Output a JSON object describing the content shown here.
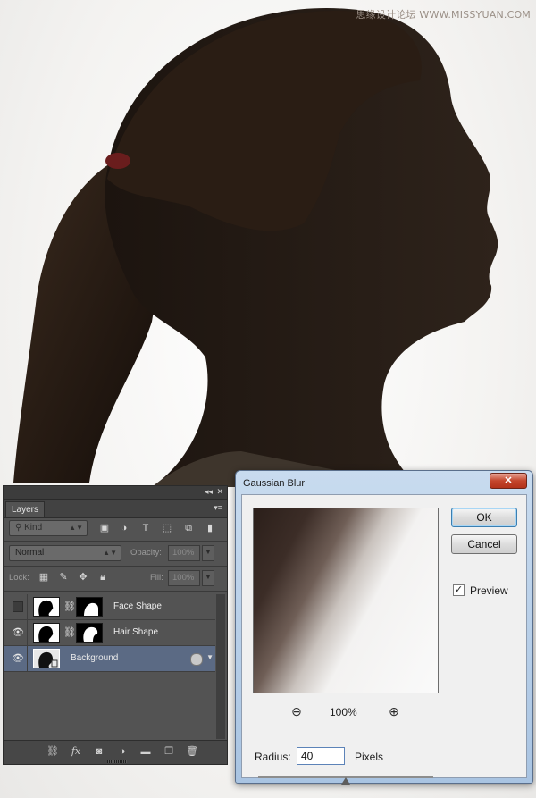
{
  "watermark": "思缘设计论坛 WWW.MISSYUAN.COM",
  "layers_panel": {
    "collapse_icon": "double-chevron-left-icon",
    "close_icon": "close-icon",
    "tab_label": "Layers",
    "menu_icon": "panel-menu-icon",
    "filter": {
      "kind_label": "Kind"
    },
    "blend_mode": "Normal",
    "opacity_label": "Opacity:",
    "opacity_value": "100%",
    "lock_label": "Lock:",
    "fill_label": "Fill:",
    "fill_value": "100%",
    "layers": [
      {
        "name": "Face Shape",
        "visible": false,
        "selected": false
      },
      {
        "name": "Hair Shape",
        "visible": true,
        "selected": false
      },
      {
        "name": "Background",
        "visible": true,
        "selected": true
      }
    ]
  },
  "gaussian_blur": {
    "title": "Gaussian Blur",
    "close_glyph": "✕",
    "ok_label": "OK",
    "cancel_label": "Cancel",
    "preview_label": "Preview",
    "preview_checked": true,
    "zoom_level": "100%",
    "radius_label": "Radius:",
    "radius_value": "40",
    "units_label": "Pixels",
    "slider_fraction": 0.5
  }
}
